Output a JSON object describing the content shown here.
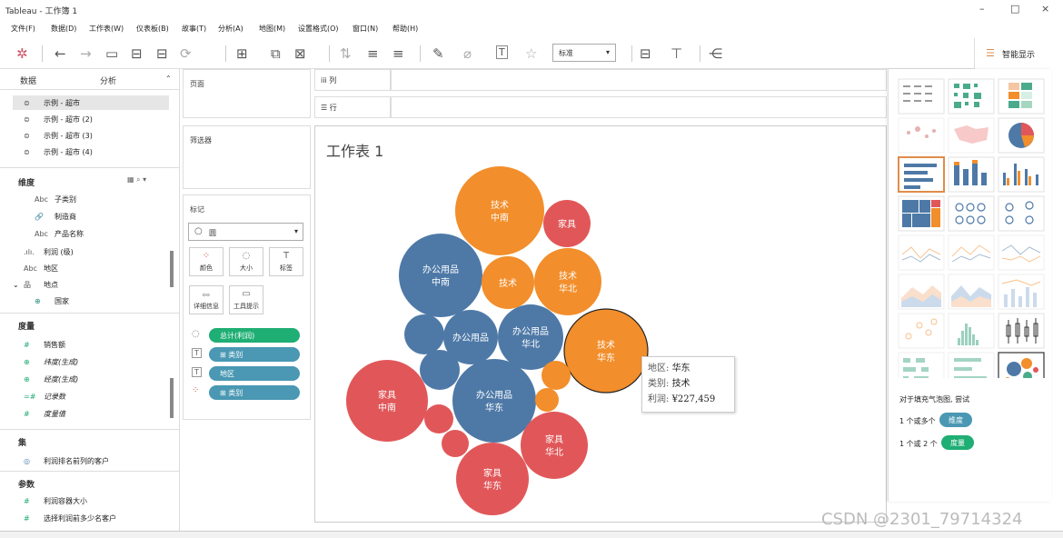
{
  "window": {
    "title": "Tableau - 工作簿 1",
    "min": "–",
    "max": "□",
    "close": "×"
  },
  "menu": [
    "文件(F)",
    "数据(D)",
    "工作表(W)",
    "仪表板(B)",
    "故事(T)",
    "分析(A)",
    "地图(M)",
    "设置格式(O)",
    "窗口(N)",
    "帮助(H)"
  ],
  "toolbar": {
    "standard_label": "标准",
    "show_me_label": "智能显示"
  },
  "left": {
    "tab_data": "数据",
    "tab_analysis": "分析",
    "datasources": [
      "示例 - 超市",
      "示例 - 超市 (2)",
      "示例 - 超市 (3)",
      "示例 - 超市 (4)"
    ],
    "dimensions_header": "维度",
    "dimensions": [
      {
        "icon": "Abc",
        "label": "子类别"
      },
      {
        "icon": "🔗",
        "label": "制造商"
      },
      {
        "icon": "Abc",
        "label": "产品名称"
      },
      {
        "icon": ".ılı.",
        "label": "利润 (级)"
      },
      {
        "icon": "Abc",
        "label": "地区"
      },
      {
        "icon": "品",
        "label": "地点"
      },
      {
        "icon": "⊕",
        "label": "国家"
      }
    ],
    "measures_header": "度量",
    "measures": [
      {
        "icon": "#",
        "label": "销售额"
      },
      {
        "icon": "⊕",
        "label": "纬度(生成)"
      },
      {
        "icon": "⊕",
        "label": "经度(生成)"
      },
      {
        "icon": "=#",
        "label": "记录数"
      },
      {
        "icon": "#",
        "label": "度量值"
      }
    ],
    "sets_header": "集",
    "sets": [
      {
        "icon": "◎",
        "label": "利润排名前列的客户"
      }
    ],
    "params_header": "参数",
    "params": [
      {
        "icon": "#",
        "label": "利润容器大小"
      },
      {
        "icon": "#",
        "label": "选择利润前多少名客户"
      }
    ]
  },
  "shelves": {
    "pages": "页面",
    "filters": "筛选器",
    "marks": "标记",
    "columns": "列",
    "rows": "行",
    "mark_type": "圆",
    "mark_buttons": [
      "颜色",
      "大小",
      "标签",
      "详细信息",
      "工具提示"
    ],
    "mark_pills": [
      {
        "icon": "◌",
        "label": "总计(利润)",
        "color": "#1fae74"
      },
      {
        "icon": "T",
        "label": "⊞ 类别",
        "color": "#4a98b3"
      },
      {
        "icon": "T",
        "label": "地区",
        "color": "#4a98b3"
      },
      {
        "icon": "⁘",
        "label": "⊞ 类别",
        "color": "#4a98b3"
      }
    ]
  },
  "sheet": {
    "title": "工作表 1"
  },
  "chart_data": {
    "type": "packed-bubble",
    "colors": {
      "办公用品": "#4e79a7",
      "技术": "#f28e2b",
      "家具": "#e15759"
    },
    "bubbles": [
      {
        "category": "技术",
        "region": "中南",
        "label": "技术\n中南"
      },
      {
        "category": "家具",
        "region": "",
        "label": "家具"
      },
      {
        "category": "办公用品",
        "region": "中南",
        "label": "办公用品\n中南"
      },
      {
        "category": "技术",
        "region": "",
        "label": "技术"
      },
      {
        "category": "技术",
        "region": "华北",
        "label": "技术\n华北"
      },
      {
        "category": "办公用品",
        "region": "",
        "label": "办公用品"
      },
      {
        "category": "办公用品",
        "region": "华北",
        "label": "办公用品\n华北"
      },
      {
        "category": "技术",
        "region": "华东",
        "label": "技术\n华东",
        "selected": true
      },
      {
        "category": "家具",
        "region": "中南",
        "label": "家具\n中南"
      },
      {
        "category": "办公用品",
        "region": "华东",
        "label": "办公用品\n华东"
      },
      {
        "category": "家具",
        "region": "华北",
        "label": "家具\n华北"
      },
      {
        "category": "家具",
        "region": "华东",
        "label": "家具\n华东"
      },
      {
        "category": "办公用品",
        "region": "",
        "label": ""
      },
      {
        "category": "办公用品",
        "region": "",
        "label": ""
      },
      {
        "category": "技术",
        "region": "",
        "label": ""
      },
      {
        "category": "技术",
        "region": "",
        "label": ""
      },
      {
        "category": "家具",
        "region": "",
        "label": ""
      },
      {
        "category": "家具",
        "region": "",
        "label": ""
      }
    ]
  },
  "tooltip": {
    "region_label": "地区:",
    "region_value": "华东",
    "category_label": "类别:",
    "category_value": "技术",
    "profit_label": "利润:",
    "profit_value": "¥227,459"
  },
  "showme": {
    "hint_title": "对于填充气泡图, 尝试",
    "hint_dims": "1 个或多个",
    "dim_pill": "维度",
    "hint_measures": "1 个或 2 个",
    "measure_pill": "度量"
  },
  "watermark": "CSDN @2301_79714324"
}
